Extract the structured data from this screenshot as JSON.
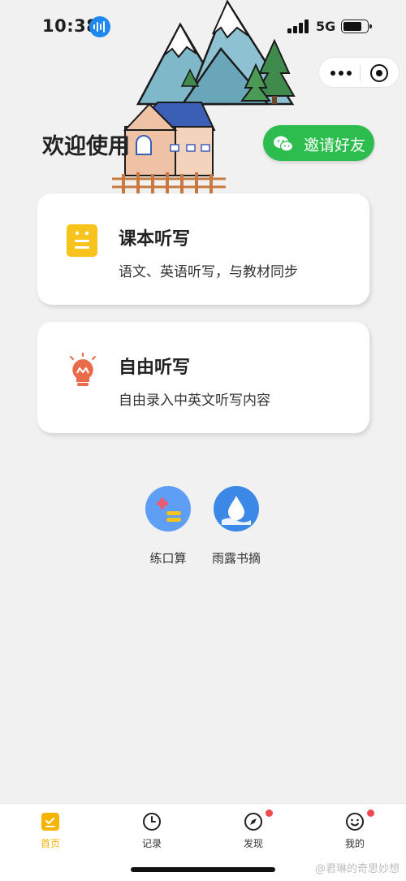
{
  "status_bar": {
    "time": "10:38",
    "network": "5G",
    "icons": [
      "siri-icon",
      "signal-icon",
      "battery-icon"
    ]
  },
  "capsule": {
    "icons": [
      "more-icon",
      "close-icon"
    ]
  },
  "header": {
    "welcome": "欢迎使用",
    "invite_label": "邀请好友"
  },
  "cards": [
    {
      "title": "课本听写",
      "desc": "语文、英语听写，与教材同步",
      "icon": "book-icon",
      "icon_color": "#f7c31c"
    },
    {
      "title": "自由听写",
      "desc": "自由录入中英文听写内容",
      "icon": "lightbulb-icon",
      "icon_color": "#ea6b4c"
    }
  ],
  "tools": [
    {
      "label": "练口算",
      "icon": "math-icon",
      "color": "#5f9ef5"
    },
    {
      "label": "雨露书摘",
      "icon": "water-drop-icon",
      "color": "#3b88e6"
    }
  ],
  "tabs": [
    {
      "label": "首页",
      "icon": "home-icon",
      "active": true,
      "badge": false
    },
    {
      "label": "记录",
      "icon": "clock-icon",
      "active": false,
      "badge": false
    },
    {
      "label": "发现",
      "icon": "compass-icon",
      "active": false,
      "badge": true
    },
    {
      "label": "我的",
      "icon": "smile-icon",
      "active": false,
      "badge": true
    }
  ],
  "colors": {
    "accent": "#2dbd4e",
    "active_tab": "#f4b400",
    "badge": "#f0494f"
  },
  "watermark": "@君琳的奇思妙想"
}
